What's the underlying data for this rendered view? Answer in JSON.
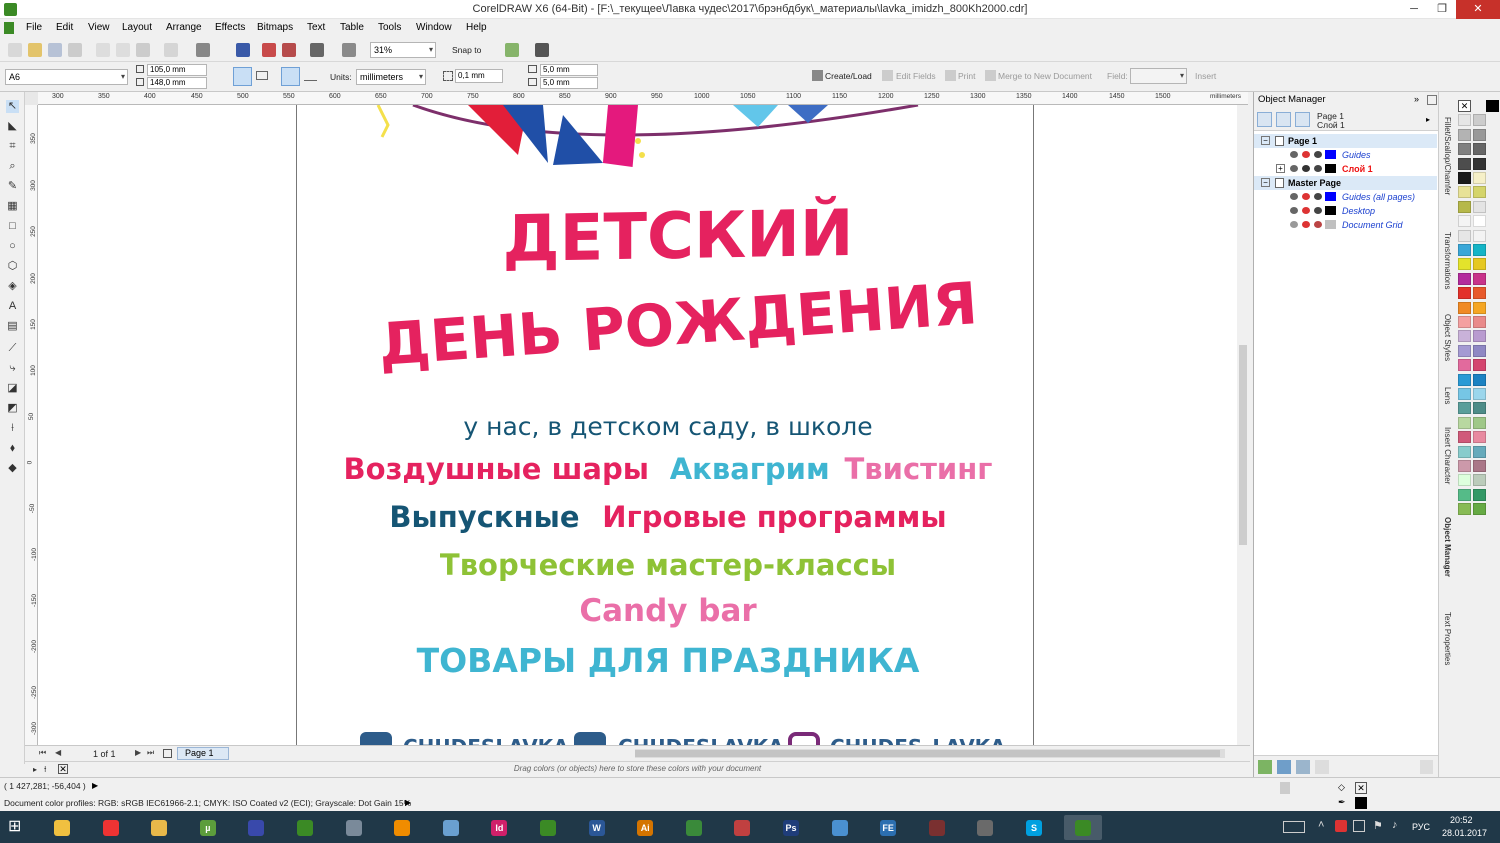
{
  "window": {
    "title": "CorelDRAW X6 (64-Bit) - [F:\\_текущее\\Лавка чудес\\2017\\брэнбдбук\\_материалы\\lavka_imidzh_800Kh2000.cdr]",
    "minimize": "─",
    "restore": "❐",
    "close": "✕"
  },
  "menu": [
    "File",
    "Edit",
    "View",
    "Layout",
    "Arrange",
    "Effects",
    "Bitmaps",
    "Text",
    "Table",
    "Tools",
    "Window",
    "Help"
  ],
  "toolbar": {
    "zoom": "31%",
    "snap_to": "Snap to"
  },
  "propbar": {
    "paper_size": "A6",
    "width": "105,0 mm",
    "height": "148,0 mm",
    "units_label": "Units:",
    "units": "millimeters",
    "nudge": "0,1 mm",
    "dup_x": "5,0 mm",
    "dup_y": "5,0 mm",
    "create_load": "Create/Load",
    "edit_fields": "Edit Fields",
    "print": "Print",
    "merge": "Merge to New Document",
    "field_label": "Field:",
    "insert": "Insert"
  },
  "rulers": {
    "h_ticks": [
      "300",
      "350",
      "400",
      "450",
      "500",
      "550",
      "600",
      "650",
      "700",
      "750",
      "800",
      "850",
      "900",
      "950",
      "1000",
      "1050",
      "1100",
      "1150",
      "1200",
      "1250",
      "1300",
      "1350",
      "1400",
      "1450",
      "1500"
    ],
    "h_unit": "millimeters",
    "v_ticks": [
      "350",
      "300",
      "250",
      "200",
      "150",
      "100",
      "50",
      "0",
      "-50",
      "-100",
      "-150",
      "-200",
      "-250",
      "-300"
    ],
    "v_unit": "millimeters"
  },
  "artwork": {
    "title_line1": "ДЕТСКИЙ",
    "title_line2": "ДЕНЬ РОЖДЕНИЯ",
    "subtitle": "у нас, в детском саду, в школе",
    "line1_a": "Воздушные шары",
    "line1_b": "Аквагрим",
    "line1_c": "Твистинг",
    "line2_a": "Выпускные",
    "line2_b": "Игровые программы",
    "line3": "Творческие мастер-классы",
    "line4": "Candy bar",
    "line5": "ТОВАРЫ ДЛЯ ПРАЗДНИКА",
    "social1": "CHUDESLAVKA",
    "social2": "CHUDESLAVKA",
    "social3": "CHUDES_LAVKA",
    "colors": {
      "pink": "#e5225f",
      "cyan": "#3fb5d1",
      "light_pink": "#ea6fa8",
      "navy": "#155574",
      "green": "#8ec236",
      "dark_blue": "#2d5c8a"
    }
  },
  "pagenav": {
    "page_count": "1 of 1",
    "page_tab": "Page 1"
  },
  "color_tray_hint": "Drag colors (or objects) here to store these colors with your document",
  "object_manager": {
    "title": "Object Manager",
    "current_page": "Page 1",
    "current_layer": "Слой 1",
    "tree": [
      {
        "label": "Page 1",
        "type": "page"
      },
      {
        "label": "Guides",
        "type": "layer",
        "color": "#0000ff"
      },
      {
        "label": "Слой 1",
        "type": "layer",
        "color": "#000000",
        "active": true
      },
      {
        "label": "Master Page",
        "type": "page"
      },
      {
        "label": "Guides (all pages)",
        "type": "layer",
        "color": "#0000ff"
      },
      {
        "label": "Desktop",
        "type": "layer",
        "color": "#000000"
      },
      {
        "label": "Document Grid",
        "type": "layer",
        "color": "#c0c0c0"
      }
    ]
  },
  "docker_tabs": [
    "Fillet/Scallop/Chamfer",
    "Transformations",
    "Object Styles",
    "Lens",
    "Insert Character",
    "Object Manager",
    "Text Properties"
  ],
  "status": {
    "coords": "( 1 427,281; -56,404 )",
    "color_profiles": "Document color profiles: RGB: sRGB IEC61966-2.1; CMYK: ISO Coated v2 (ECI); Grayscale: Dot Gain 15%"
  },
  "taskbar": {
    "apps": [
      "Explorer",
      "Chrome",
      "Files",
      "uTorrent",
      "Save",
      "CorelDRAW",
      "Calculator",
      "VLC",
      "Notes",
      "InDesign",
      "Corel",
      "Word",
      "Illustrator",
      "Evernote",
      "Picasa",
      "Photoshop",
      "Globe",
      "FE",
      "Witcher",
      "Tool",
      "Skype",
      "CorelDRAW X6"
    ],
    "lang": "РУС",
    "time": "20:52",
    "date": "28.01.2017"
  }
}
